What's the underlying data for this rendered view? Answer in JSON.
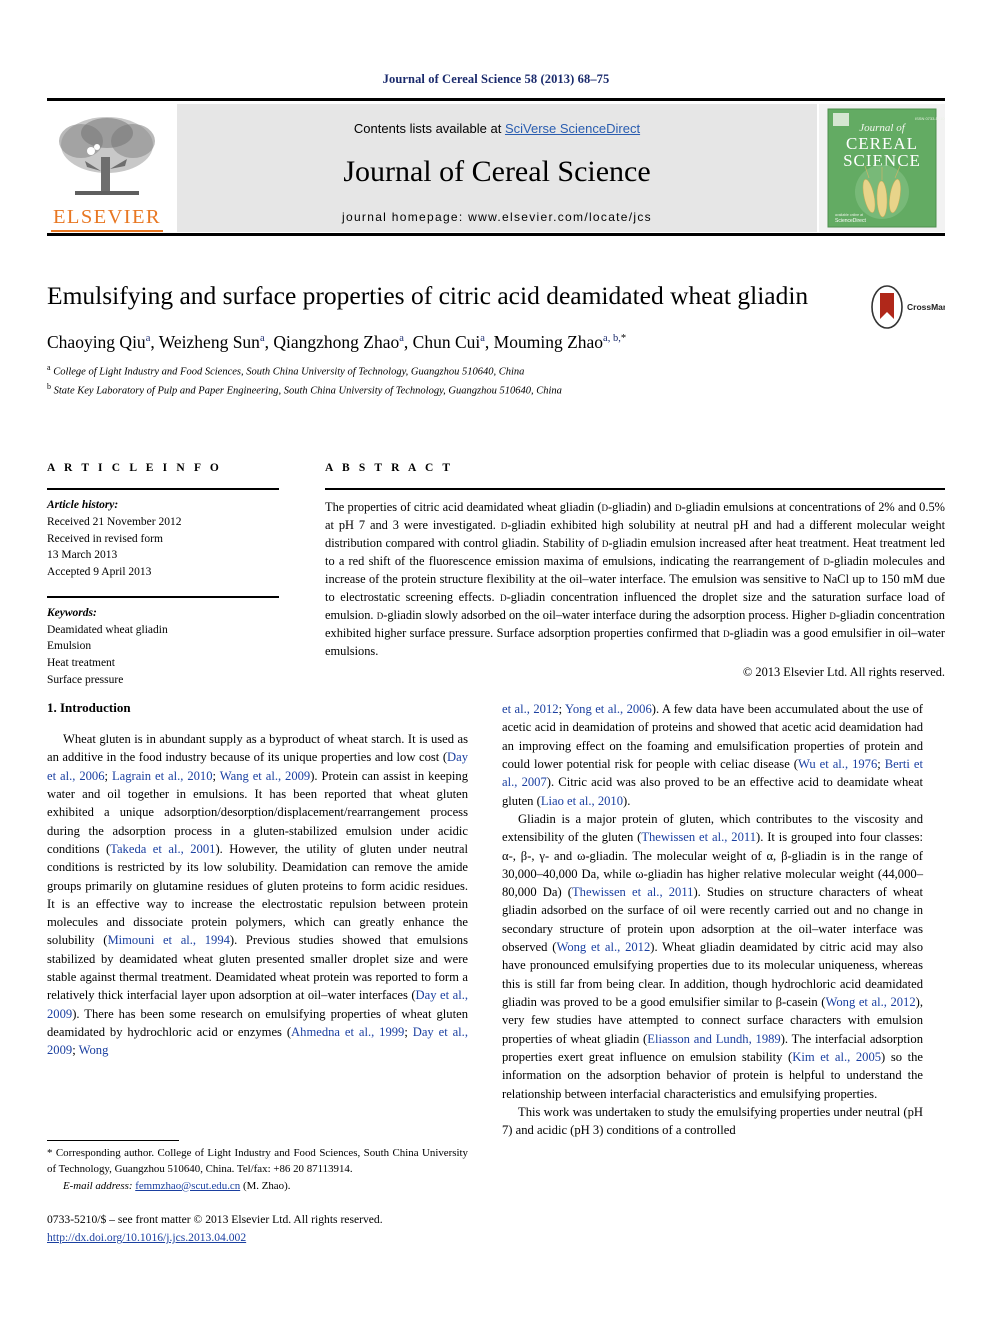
{
  "running_head": "Journal of Cereal Science 58 (2013) 68–75",
  "masthead": {
    "contents_prefix": "Contents lists available at ",
    "sciencedirect": "SciVerse ScienceDirect",
    "journal_title": "Journal of Cereal Science",
    "homepage": "journal homepage: www.elsevier.com/locate/jcs",
    "publisher_logo_text": "ELSEVIER",
    "cover_line1": "Journal of",
    "cover_line2": "CEREAL",
    "cover_line3": "SCIENCE",
    "cover_corner": "ISSN 0733-5210",
    "cover_footer": "ScienceDirect",
    "colors": {
      "elsevier_orange": "#E87722",
      "link_blue": "#2a5db0",
      "cover_green": "#5aa85a",
      "running_head_blue": "#1a2a6c"
    }
  },
  "crossmark": {
    "label": "CrossMark",
    "color": "#b0281a"
  },
  "title": "Emulsifying and surface properties of citric acid deamidated wheat gliadin",
  "authors": [
    {
      "name": "Chaoying Qiu",
      "sup": "a",
      "sep": ", "
    },
    {
      "name": "Weizheng Sun",
      "sup": "a",
      "sep": ", "
    },
    {
      "name": "Qiangzhong Zhao",
      "sup": "a",
      "sep": ", "
    },
    {
      "name": "Chun Cui",
      "sup": "a",
      "sep": ", "
    },
    {
      "name": "Mouming Zhao",
      "sup": "a, b,",
      "star": "*",
      "sep": ""
    }
  ],
  "affiliations": [
    {
      "mark": "a",
      "text": "College of Light Industry and Food Sciences, South China University of Technology, Guangzhou 510640, China"
    },
    {
      "mark": "b",
      "text": "State Key Laboratory of Pulp and Paper Engineering, South China University of Technology, Guangzhou 510640, China"
    }
  ],
  "article_info": {
    "heading": "A R T I C L E   I N F O",
    "history_label": "Article history:",
    "history": [
      "Received 21 November 2012",
      "Received in revised form",
      "13 March 2013",
      "Accepted 9 April 2013"
    ],
    "keywords_label": "Keywords:",
    "keywords": [
      "Deamidated wheat gliadin",
      "Emulsion",
      "Heat treatment",
      "Surface pressure"
    ]
  },
  "abstract": {
    "heading": "A B S T R A C T",
    "text": "The properties of citric acid deamidated wheat gliadin (D-gliadin) and D-gliadin emulsions at concentrations of 2% and 0.5% at pH 7 and 3 were investigated. D-gliadin exhibited high solubility at neutral pH and had a different molecular weight distribution compared with control gliadin. Stability of D-gliadin emulsion increased after heat treatment. Heat treatment led to a red shift of the fluorescence emission maxima of emulsions, indicating the rearrangement of D-gliadin molecules and increase of the protein structure flexibility at the oil–water interface. The emulsion was sensitive to NaCl up to 150 mM due to electrostatic screening effects. D-gliadin concentration influenced the droplet size and the saturation surface load of emulsion. D-gliadin slowly adsorbed on the oil–water interface during the adsorption process. Higher D-gliadin concentration exhibited higher surface pressure. Surface adsorption properties confirmed that D-gliadin was a good emulsifier in oil–water emulsions.",
    "copyright": "© 2013 Elsevier Ltd. All rights reserved."
  },
  "section_heading": "1. Introduction",
  "intro_left": [
    "Wheat gluten is in abundant supply as a byproduct of wheat starch. It is used as an additive in the food industry because of its unique properties and low cost (|Day et al., 2006|; |Lagrain et al., 2010|; |Wang et al., 2009|). Protein can assist in keeping water and oil together in emulsions. It has been reported that wheat gluten exhibited a unique adsorption/desorption/displacement/rearrangement process during the adsorption process in a gluten-stabilized emulsion under acidic conditions (|Takeda et al., 2001|). However, the utility of gluten under neutral conditions is restricted by its low solubility. Deamidation can remove the amide groups primarily on glutamine residues of gluten proteins to form acidic residues. It is an effective way to increase the electrostatic repulsion between protein molecules and dissociate protein polymers, which can greatly enhance the solubility (|Mimouni et al., 1994|). Previous studies showed that emulsions stabilized by deamidated wheat gluten presented smaller droplet size and were stable against thermal treatment. Deamidated wheat protein was reported to form a relatively thick interfacial layer upon adsorption at oil–water interfaces (|Day et al., 2009|). There has been some research on emulsifying properties of wheat gluten deamidated by hydrochloric acid or enzymes (|Ahmedna et al., 1999|; |Day et al., 2009|; |Wong|"
  ],
  "intro_right": [
    "|et al., 2012|; |Yong et al., 2006|). A few data have been accumulated about the use of acetic acid in deamidation of proteins and showed that acetic acid deamidation had an improving effect on the foaming and emulsification properties of protein and could lower potential risk for people with celiac disease (|Wu et al., 1976|; |Berti et al., 2007|). Citric acid was also proved to be an effective acid to deamidate wheat gluten (|Liao et al., 2010|).",
    "Gliadin is a major protein of gluten, which contributes to the viscosity and extensibility of the gluten (|Thewissen et al., 2011|). It is grouped into four classes: α-, β-, γ- and ω-gliadin. The molecular weight of α, β-gliadin is in the range of 30,000–40,000 Da, while ω-gliadin has higher relative molecular weight (44,000–80,000 Da) (|Thewissen et al., 2011|). Studies on structure characters of wheat gliadin adsorbed on the surface of oil were recently carried out and no change in secondary structure of protein upon adsorption at the oil–water interface was observed (|Wong et al., 2012|). Wheat gliadin deamidated by citric acid may also have pronounced emulsifying properties due to its molecular uniqueness, whereas this is still far from being clear. In addition, though hydrochloric acid deamidated gliadin was proved to be a good emulsifier similar to β-casein (|Wong et al., 2012|), very few studies have attempted to connect surface characters with emulsion properties of wheat gliadin (|Eliasson and Lundh, 1989|). The interfacial adsorption properties exert great influence on emulsion stability (|Kim et al., 2005|) so the information on the adsorption behavior of protein is helpful to understand the relationship between interfacial characteristics and emulsifying properties.",
    "This work was undertaken to study the emulsifying properties under neutral (pH 7) and acidic (pH 3) conditions of a controlled"
  ],
  "footnote": {
    "corresponding": "* Corresponding author. College of Light Industry and Food Sciences, South China University of Technology, Guangzhou 510640, China. Tel/fax: +86 20 87113914.",
    "email_label": "E-mail address:",
    "email": "femmzhao@scut.edu.cn",
    "email_suffix": "(M. Zhao)."
  },
  "colophon": {
    "line1": "0733-5210/$ – see front matter © 2013 Elsevier Ltd. All rights reserved.",
    "doi": "http://dx.doi.org/10.1016/j.jcs.2013.04.002"
  }
}
